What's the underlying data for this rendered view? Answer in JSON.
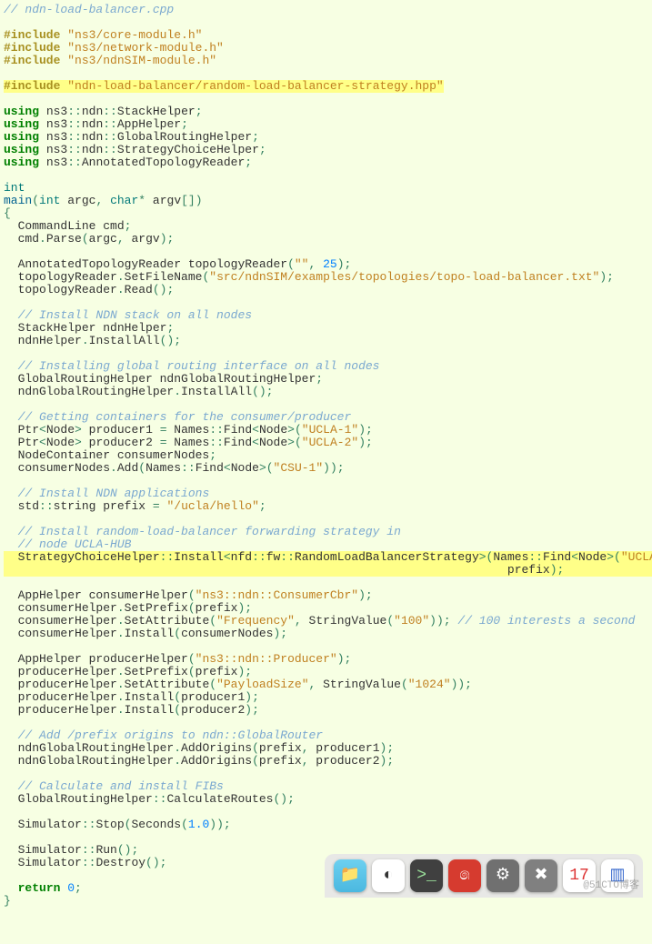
{
  "code_html": "<span class=\"cmt\">// ndn-load-balancer.cpp</span>\n\n<span class=\"pp\">#include</span> <span class=\"str\">\"ns3/core-module.h\"</span>\n<span class=\"pp\">#include</span> <span class=\"str\">\"ns3/network-module.h\"</span>\n<span class=\"pp\">#include</span> <span class=\"str\">\"ns3/ndnSIM-module.h\"</span>\n\n<span class=\"hl\"><span class=\"pp\">#include</span> <span class=\"str\">\"ndn-load-balancer/random-load-balancer-strategy.hpp\"</span></span>\n\n<span class=\"kw\">using</span> ns3<span class=\"nc\">::</span>ndn<span class=\"nc\">::</span>StackHelper<span class=\"nc\">;</span>\n<span class=\"kw\">using</span> ns3<span class=\"nc\">::</span>ndn<span class=\"nc\">::</span>AppHelper<span class=\"nc\">;</span>\n<span class=\"kw\">using</span> ns3<span class=\"nc\">::</span>ndn<span class=\"nc\">::</span>GlobalRoutingHelper<span class=\"nc\">;</span>\n<span class=\"kw\">using</span> ns3<span class=\"nc\">::</span>ndn<span class=\"nc\">::</span>StrategyChoiceHelper<span class=\"nc\">;</span>\n<span class=\"kw\">using</span> ns3<span class=\"nc\">::</span>AnnotatedTopologyReader<span class=\"nc\">;</span>\n\n<span class=\"typ\">int</span>\n<span class=\"fn\">main</span><span class=\"nc\">(</span><span class=\"typ\">int</span> argc<span class=\"nc\">,</span> <span class=\"typ\">char</span><span class=\"nc\">*</span> argv<span class=\"nc\">[])</span>\n<span class=\"nc\">{</span>\n  CommandLine cmd<span class=\"nc\">;</span>\n  cmd<span class=\"nc\">.</span>Parse<span class=\"nc\">(</span>argc<span class=\"nc\">,</span> argv<span class=\"nc\">);</span>\n\n  AnnotatedTopologyReader topologyReader<span class=\"nc\">(</span><span class=\"str\">\"\"</span><span class=\"nc\">,</span> <span class=\"num\">25</span><span class=\"nc\">);</span>\n  topologyReader<span class=\"nc\">.</span>SetFileName<span class=\"nc\">(</span><span class=\"str\">\"src/ndnSIM/examples/topologies/topo-load-balancer.txt\"</span><span class=\"nc\">);</span>\n  topologyReader<span class=\"nc\">.</span>Read<span class=\"nc\">();</span>\n\n  <span class=\"cmt\">// Install NDN stack on all nodes</span>\n  StackHelper ndnHelper<span class=\"nc\">;</span>\n  ndnHelper<span class=\"nc\">.</span>InstallAll<span class=\"nc\">();</span>\n\n  <span class=\"cmt\">// Installing global routing interface on all nodes</span>\n  GlobalRoutingHelper ndnGlobalRoutingHelper<span class=\"nc\">;</span>\n  ndnGlobalRoutingHelper<span class=\"nc\">.</span>InstallAll<span class=\"nc\">();</span>\n\n  <span class=\"cmt\">// Getting containers for the consumer/producer</span>\n  Ptr<span class=\"nc\">&lt;</span>Node<span class=\"nc\">&gt;</span> producer1 <span class=\"nc\">=</span> Names<span class=\"nc\">::</span>Find<span class=\"nc\">&lt;</span>Node<span class=\"nc\">&gt;(</span><span class=\"str\">\"UCLA-1\"</span><span class=\"nc\">);</span>\n  Ptr<span class=\"nc\">&lt;</span>Node<span class=\"nc\">&gt;</span> producer2 <span class=\"nc\">=</span> Names<span class=\"nc\">::</span>Find<span class=\"nc\">&lt;</span>Node<span class=\"nc\">&gt;(</span><span class=\"str\">\"UCLA-2\"</span><span class=\"nc\">);</span>\n  NodeContainer consumerNodes<span class=\"nc\">;</span>\n  consumerNodes<span class=\"nc\">.</span>Add<span class=\"nc\">(</span>Names<span class=\"nc\">::</span>Find<span class=\"nc\">&lt;</span>Node<span class=\"nc\">&gt;(</span><span class=\"str\">\"CSU-1\"</span><span class=\"nc\">));</span>\n\n  <span class=\"cmt\">// Install NDN applications</span>\n  std<span class=\"nc\">::</span>string prefix <span class=\"nc\">=</span> <span class=\"str\">\"/ucla/hello\"</span><span class=\"nc\">;</span>\n\n  <span class=\"cmt\">// Install random-load-balancer forwarding strategy in</span>\n  <span class=\"cmt\">// node UCLA-HUB</span>\n<span class=\"hl hl-full\">  StrategyChoiceHelper<span class=\"nc\">::</span>Install<span class=\"nc\">&lt;</span>nfd<span class=\"nc\">::</span>fw<span class=\"nc\">::</span>RandomLoadBalancerStrategy<span class=\"nc\">&gt;(</span>Names<span class=\"nc\">::</span>Find<span class=\"nc\">&lt;</span>Node<span class=\"nc\">&gt;(</span><span class=\"str\">\"UCLA-HUB\"</span><span class=\"nc\">),</span>\n                                                                       prefix<span class=\"nc\">);</span></span>\n\n  AppHelper consumerHelper<span class=\"nc\">(</span><span class=\"str\">\"ns3::ndn::ConsumerCbr\"</span><span class=\"nc\">);</span>\n  consumerHelper<span class=\"nc\">.</span>SetPrefix<span class=\"nc\">(</span>prefix<span class=\"nc\">);</span>\n  consumerHelper<span class=\"nc\">.</span>SetAttribute<span class=\"nc\">(</span><span class=\"str\">\"Frequency\"</span><span class=\"nc\">,</span> StringValue<span class=\"nc\">(</span><span class=\"str\">\"100\"</span><span class=\"nc\">));</span> <span class=\"cmt\">// 100 interests a second</span>\n  consumerHelper<span class=\"nc\">.</span>Install<span class=\"nc\">(</span>consumerNodes<span class=\"nc\">);</span>\n\n  AppHelper producerHelper<span class=\"nc\">(</span><span class=\"str\">\"ns3::ndn::Producer\"</span><span class=\"nc\">);</span>\n  producerHelper<span class=\"nc\">.</span>SetPrefix<span class=\"nc\">(</span>prefix<span class=\"nc\">);</span>\n  producerHelper<span class=\"nc\">.</span>SetAttribute<span class=\"nc\">(</span><span class=\"str\">\"PayloadSize\"</span><span class=\"nc\">,</span> StringValue<span class=\"nc\">(</span><span class=\"str\">\"1024\"</span><span class=\"nc\">));</span>\n  producerHelper<span class=\"nc\">.</span>Install<span class=\"nc\">(</span>producer1<span class=\"nc\">);</span>\n  producerHelper<span class=\"nc\">.</span>Install<span class=\"nc\">(</span>producer2<span class=\"nc\">);</span>\n\n  <span class=\"cmt\">// Add /prefix origins to ndn::GlobalRouter</span>\n  ndnGlobalRoutingHelper<span class=\"nc\">.</span>AddOrigins<span class=\"nc\">(</span>prefix<span class=\"nc\">,</span> producer1<span class=\"nc\">);</span>\n  ndnGlobalRoutingHelper<span class=\"nc\">.</span>AddOrigins<span class=\"nc\">(</span>prefix<span class=\"nc\">,</span> producer2<span class=\"nc\">);</span>\n\n  <span class=\"cmt\">// Calculate and install FIBs</span>\n  GlobalRoutingHelper<span class=\"nc\">::</span>CalculateRoutes<span class=\"nc\">();</span>\n\n  Simulator<span class=\"nc\">::</span>Stop<span class=\"nc\">(</span>Seconds<span class=\"nc\">(</span><span class=\"num\">1.0</span><span class=\"nc\">));</span>\n\n  Simulator<span class=\"nc\">::</span>Run<span class=\"nc\">();</span>\n  Simulator<span class=\"nc\">::</span>Destroy<span class=\"nc\">();</span>\n\n  <span class=\"kw\">return</span> <span class=\"num\">0</span><span class=\"nc\">;</span>\n<span class=\"nc\">}</span>",
  "dock": {
    "items": [
      {
        "name": "files",
        "label": "📁",
        "cls": "di-files"
      },
      {
        "name": "chrome",
        "label": "◐",
        "cls": "di-chrome"
      },
      {
        "name": "terminal",
        "label": ">_",
        "cls": "di-term"
      },
      {
        "name": "netease",
        "label": "෧",
        "cls": "di-netease"
      },
      {
        "name": "settings",
        "label": "⚙",
        "cls": "di-set"
      },
      {
        "name": "tools",
        "label": "✖",
        "cls": "di-x"
      },
      {
        "name": "calendar",
        "label": "17",
        "cls": "di-cal"
      },
      {
        "name": "sysmon",
        "label": "▥",
        "cls": "di-sys"
      }
    ]
  },
  "watermark": "@51CTO博客"
}
